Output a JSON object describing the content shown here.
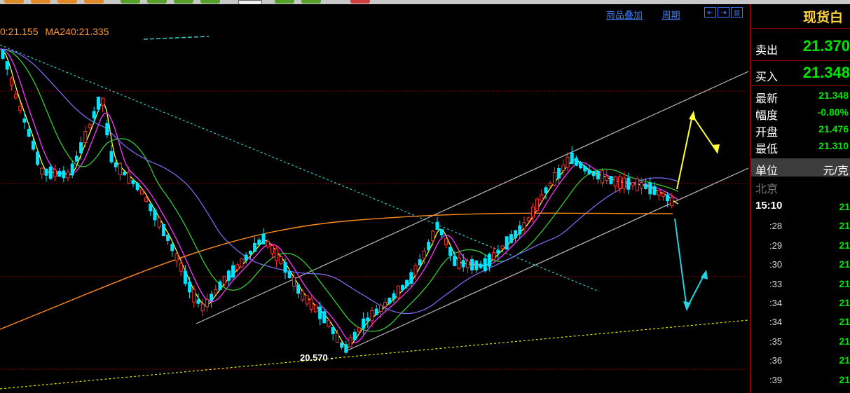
{
  "header": {
    "overlay_link": "商品叠加",
    "period_link": "周期",
    "nav_buttons": [
      "⇤",
      "⇥",
      "▥"
    ]
  },
  "legend": {
    "ma_prev": "0:21.155",
    "ma240": "MA240:21.335"
  },
  "chart_data": {
    "type": "candlestick",
    "title": "",
    "annotation_low": "20.570",
    "low_value": 20.57,
    "price_levels_red_dashed": 4,
    "series": [
      {
        "name": "MA240",
        "value": 21.335,
        "color": "#ff8c1a"
      }
    ],
    "colors": {
      "up": "#ff3333",
      "down": "#00e5ff",
      "ma_short": "#ffffff",
      "ma_5": "#ffff33",
      "ma_10": "#ff33ff",
      "ma_20": "#33cc33",
      "ma_60": "#7b68ee",
      "ma_240": "#ff8c1a",
      "channel": "#bbbbbb",
      "trend_dash_cyan": "#33cccc",
      "trend_dash_yellow": "#e6e600",
      "arrow_up": "#ffff33",
      "arrow_down": "#22d4e0"
    }
  },
  "panel": {
    "title": "现货白",
    "sell_label": "卖出",
    "sell_value": "21.370",
    "buy_label": "买入",
    "buy_value": "21.348",
    "rows": [
      {
        "label": "最新",
        "value": "21.348"
      },
      {
        "label": "幅度",
        "value": "-0.80%"
      },
      {
        "label": "开盘",
        "value": "21.476"
      },
      {
        "label": "最低",
        "value": "21.310"
      }
    ],
    "unit_label": "单位",
    "unit_value": "元/克",
    "location": "北京",
    "ticks": [
      {
        "time": "15:10",
        "price": "21"
      },
      {
        "time": ":28",
        "price": "21"
      },
      {
        "time": ":29",
        "price": "21"
      },
      {
        "time": ":30",
        "price": "21"
      },
      {
        "time": ":33",
        "price": "21"
      },
      {
        "time": ":34",
        "price": "21"
      },
      {
        "time": ":34",
        "price": "21"
      },
      {
        "time": ":35",
        "price": "21"
      },
      {
        "time": ":36",
        "price": "21"
      },
      {
        "time": ":39",
        "price": "21"
      }
    ]
  }
}
